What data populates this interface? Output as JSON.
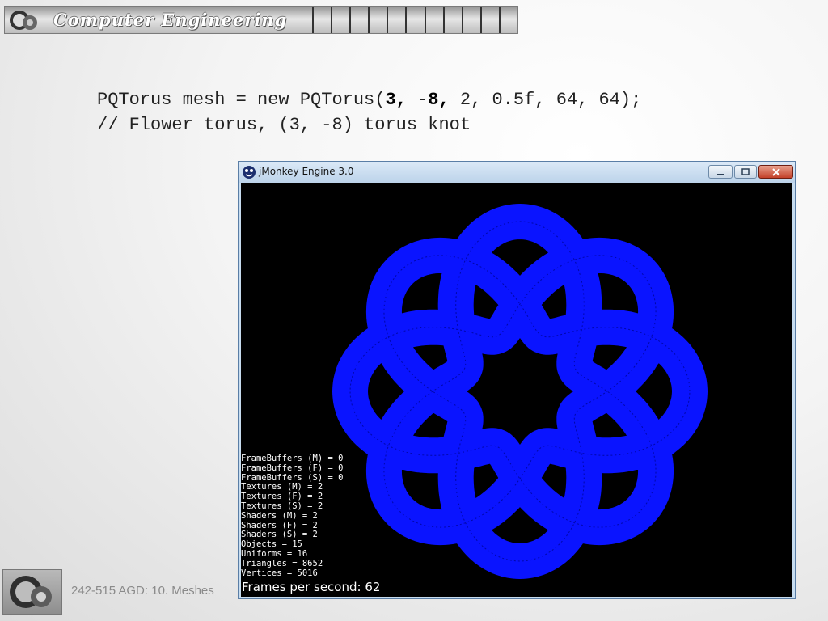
{
  "header": {
    "title": "Computer Engineering",
    "logo_icon": "gear-wheel-logo-icon"
  },
  "code": {
    "line1_prefix": "PQTorus mesh = new PQTorus(",
    "line1_bold_p": "3,",
    "line1_sep": " -",
    "line1_bold_q": "8,",
    "line1_suffix": " 2, 0.5f, 64, 64);",
    "line2": "// Flower torus, (3, -8) torus knot"
  },
  "window": {
    "title": "jMonkey Engine 3.0",
    "icon": "jmonkey-app-icon",
    "buttons": {
      "minimize": "minimize-icon",
      "maximize": "maximize-icon",
      "close": "close-icon"
    },
    "mesh_color": "#0a14ff",
    "stats": [
      "FrameBuffers (M) = 0",
      "FrameBuffers (F) = 0",
      "FrameBuffers (S) = 0",
      "Textures (M) = 2",
      "Textures (F) = 2",
      "Textures (S) = 2",
      "Shaders (M) = 2",
      "Shaders (F) = 2",
      "Shaders (S) = 2",
      "Objects = 15",
      "Uniforms = 16",
      "Triangles = 8652",
      "Vertices = 5016"
    ],
    "fps_text": "Frames per second: 62"
  },
  "footer": {
    "text": "242-515 AGD: 10. Meshes",
    "logo_icon": "gear-wheel-logo-icon"
  }
}
